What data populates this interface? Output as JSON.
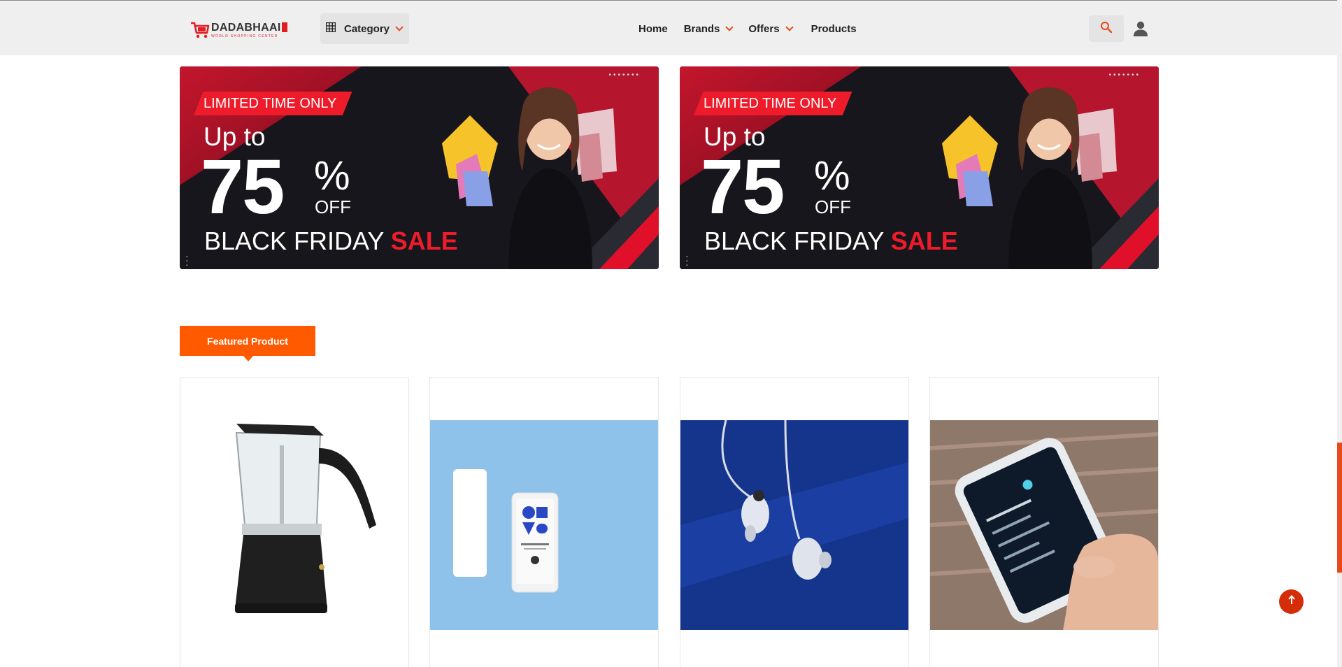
{
  "header": {
    "logo": {
      "text_dark": "DADABHAAI",
      "tagline": "WORLD SHOPPING CENTER"
    },
    "category_label": "Category",
    "nav": [
      {
        "label": "Home",
        "has_dropdown": false
      },
      {
        "label": "Brands",
        "has_dropdown": true
      },
      {
        "label": "Offers",
        "has_dropdown": true
      },
      {
        "label": "Products",
        "has_dropdown": false
      }
    ],
    "icons": {
      "category": "grid-icon",
      "search": "search-icon",
      "account": "user-icon",
      "dropdown": "chevron-down-icon"
    }
  },
  "banners": [
    {
      "tag": "LIMITED TIME ONLY",
      "upto": "Up to",
      "number": "75",
      "percent": "%",
      "off": "OFF",
      "title_white": "BLACK FRIDAY",
      "title_red": "SALE"
    },
    {
      "tag": "LIMITED TIME ONLY",
      "upto": "Up to",
      "number": "75",
      "percent": "%",
      "off": "OFF",
      "title_white": "BLACK FRIDAY",
      "title_red": "SALE"
    }
  ],
  "featured": {
    "tab_label": "Featured Product",
    "products": [
      {
        "image": "moka-pot-image"
      },
      {
        "image": "music-player-white-image"
      },
      {
        "image": "clear-earphones-image"
      },
      {
        "image": "handheld-player-image"
      }
    ]
  },
  "colors": {
    "accent": "#ff5a00",
    "brand_red": "#e31b23",
    "sale_red": "#ee1c2b",
    "scroll_button": "#d52d08"
  },
  "scroll_top_icon": "arrow-up-icon"
}
